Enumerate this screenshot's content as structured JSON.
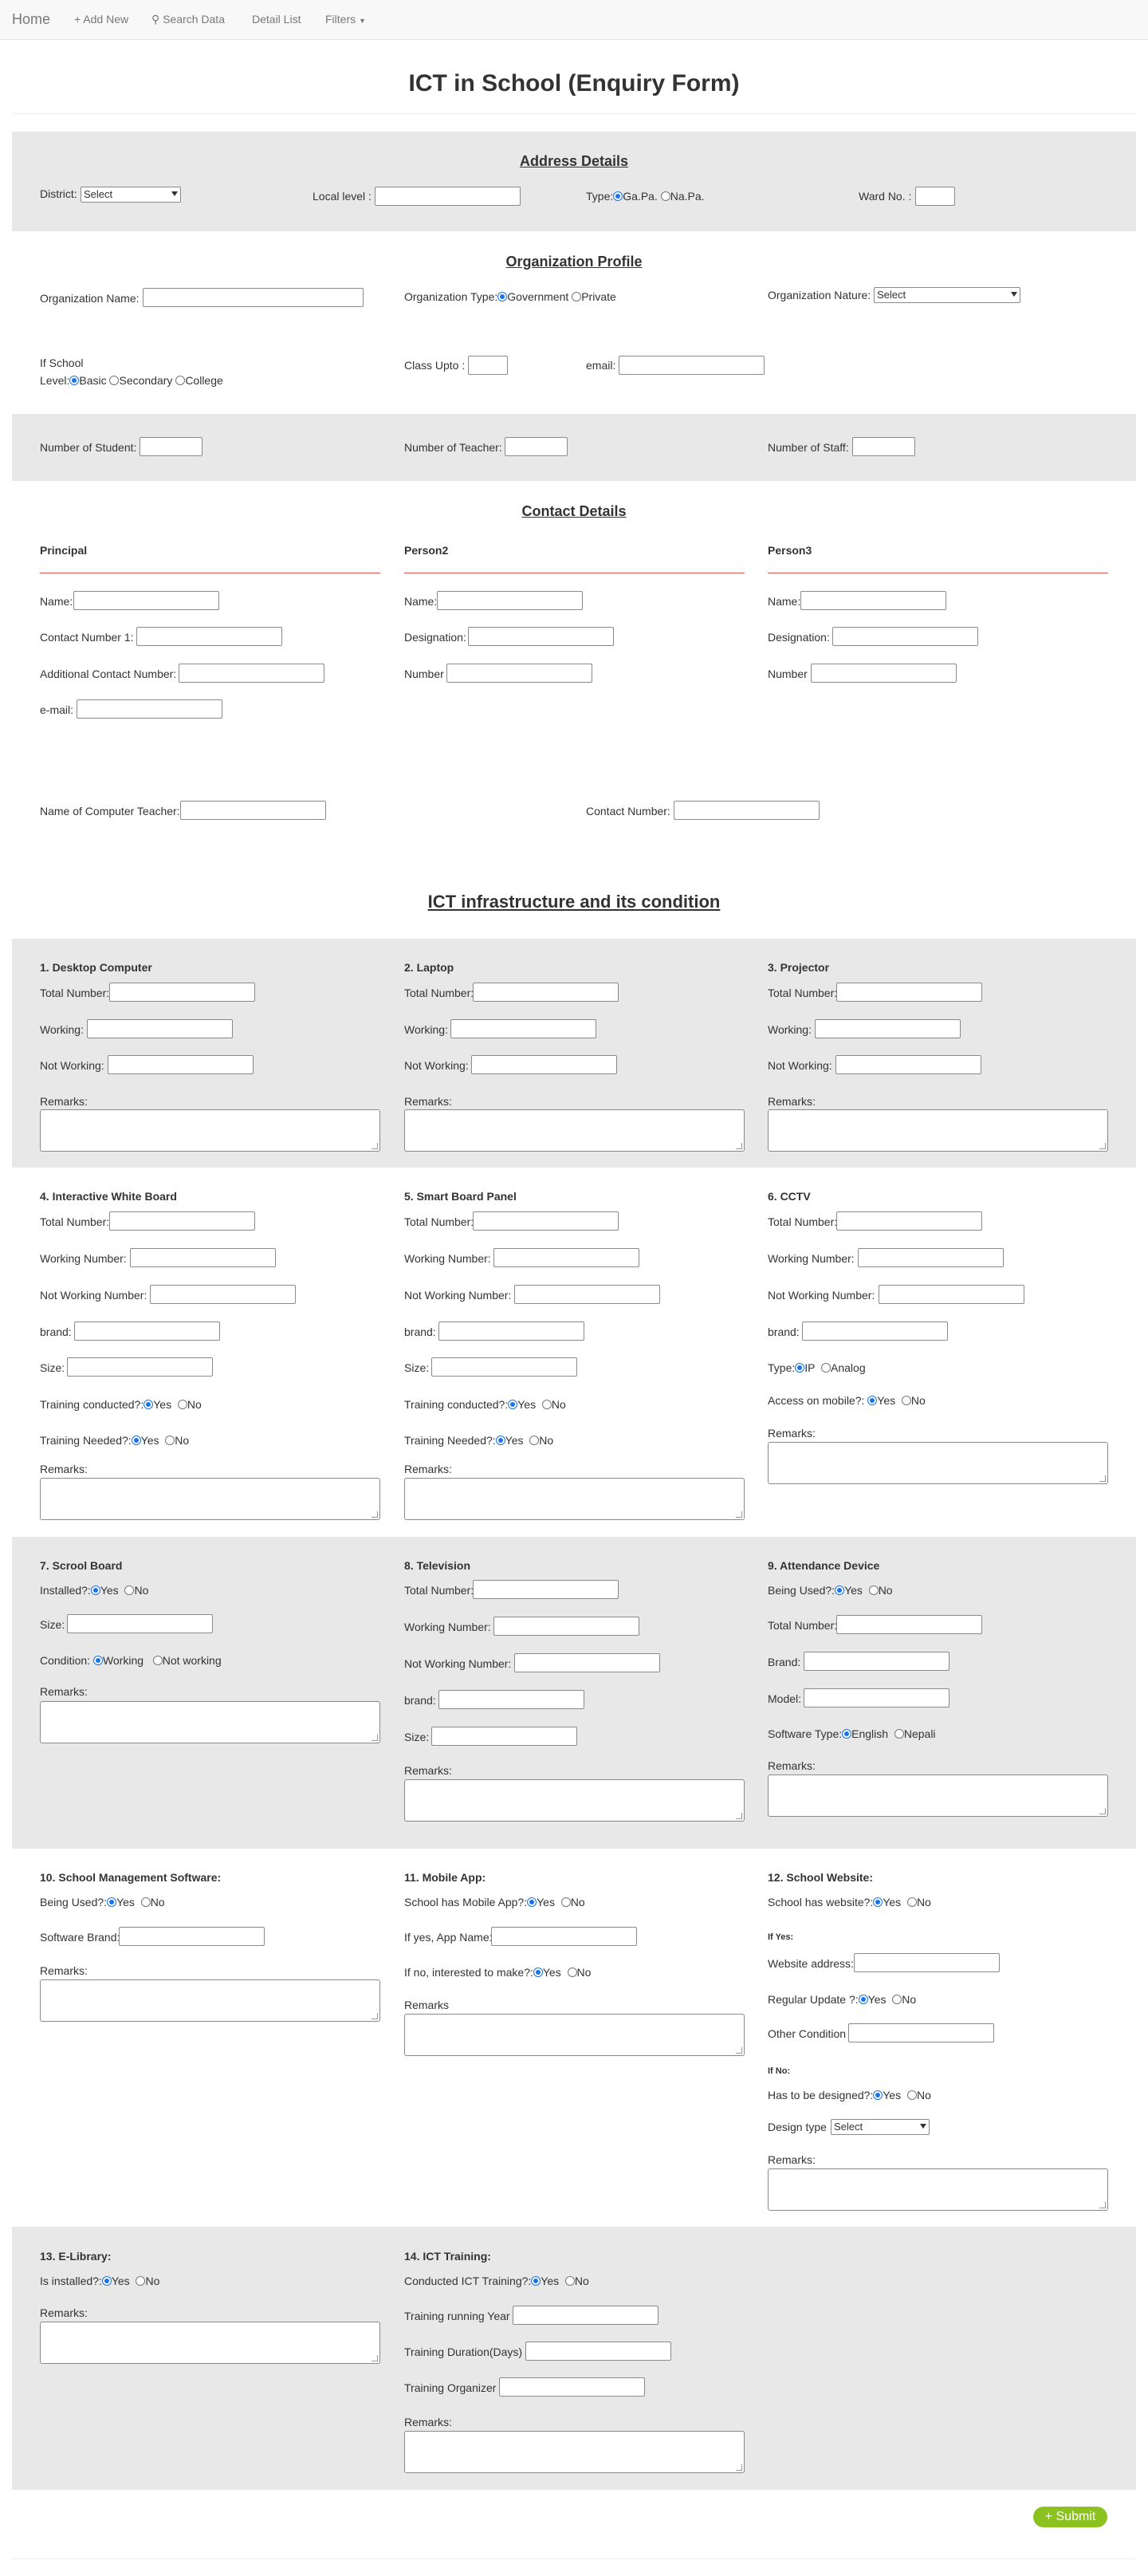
{
  "nav": {
    "home": "Home",
    "add_new": "+ Add New",
    "search": "Search Data",
    "detail": "Detail List",
    "filters": "Filters"
  },
  "title": "ICT in School (Enquiry Form)",
  "address": {
    "heading": "Address Details",
    "district": "District:",
    "district_sel": "Select",
    "local_level": "Local level :",
    "type": "Type:",
    "gapa": "Ga.Pa.",
    "napa": "Na.Pa.",
    "ward": "Ward No. :"
  },
  "org": {
    "heading": "Organization Profile",
    "name": "Organization Name:",
    "type": "Organization Type:",
    "government": "Government",
    "private": "Private",
    "nature": "Organization Nature:",
    "nature_sel": "Select",
    "if_school": "If School",
    "level": "Level:",
    "basic": "Basic",
    "secondary": "Secondary",
    "college": "College",
    "class_upto": "Class Upto :",
    "email": "email:",
    "students": "Number of Student:",
    "teachers": "Number of Teacher:",
    "staff": "Number of Staff:"
  },
  "contact": {
    "heading": "Contact Details",
    "principal": "Principal",
    "person2": "Person2",
    "person3": "Person3",
    "name": "Name:",
    "contact1": "Contact Number 1:",
    "additional": "Additional Contact Number:",
    "email": "e-mail:",
    "designation": "Designation:",
    "number": "Number",
    "computer_teacher": "Name of Computer Teacher:",
    "contact_number": "Contact Number:"
  },
  "ict": {
    "heading": "ICT infrastructure and its condition",
    "total": "Total Number:",
    "working": "Working:",
    "not_working": "Not Working:",
    "remarks": "Remarks:",
    "remarks_plain": "Remarks",
    "working_number": "Working Number:",
    "not_working_number": "Not Working Number:",
    "brand": "brand:",
    "size": "Size:",
    "training_conducted": "Training conducted?:",
    "training_needed": "Training Needed?:",
    "yes": "Yes",
    "no": "No",
    "desktop": "1. Desktop Computer",
    "laptop": "2. Laptop",
    "projector": "3. Projector",
    "iwb": "4. Interactive White Board",
    "smart": "5. Smart Board Panel",
    "cctv": "6. CCTV",
    "cctv_type": "Type:",
    "ip": "IP",
    "analog": "Analog",
    "access_mobile": "Access on mobile?:",
    "scroll": "7. Scrool Board",
    "installed": "Installed?:",
    "size2": "Size:",
    "condition": "Condition:",
    "cond_working": "Working",
    "cond_not": "Not working",
    "tv": "8. Television",
    "brand_cap": "Brand:",
    "attendance": "9. Attendance Device",
    "being_used": "Being Used?:",
    "model": "Model:",
    "software_type": "Software Type:",
    "english": "English",
    "nepali": "Nepali",
    "sms": "10. School Management Software:",
    "software_brand": "Software Brand:",
    "mobile": "11. Mobile App:",
    "has_app": "School has Mobile App?:",
    "app_name": "If yes, App Name:",
    "interested": "If no, interested to make?:",
    "website": "12. School Website:",
    "has_website": "School has website?:",
    "if_yes": "If Yes:",
    "web_address": "Website address:",
    "regular_update": "Regular Update ?:",
    "other_condition": "Other Condition",
    "if_no": "If No:",
    "to_design": "Has to be designed?:",
    "design_type": "Design type",
    "design_sel": "Select",
    "elibrary": "13. E-Library:",
    "is_installed": "Is installed?:",
    "training": "14. ICT Training:",
    "conducted_training": "Conducted ICT Training?:",
    "running_year": "Training running Year",
    "duration": "Training Duration(Days)",
    "organizer": "Training Organizer"
  },
  "submit": "+ Submit"
}
